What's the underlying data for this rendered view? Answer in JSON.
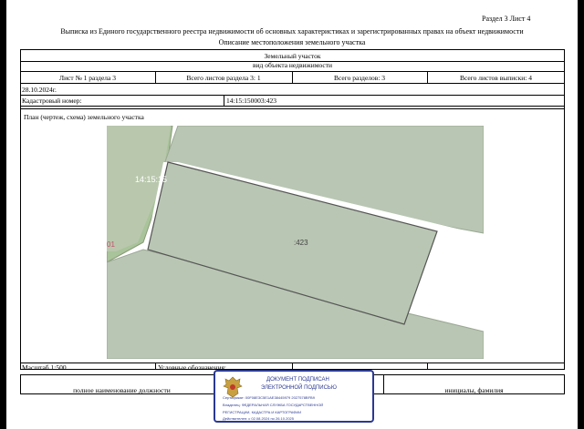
{
  "header": {
    "section": "Раздел 3    Лист 4",
    "title": "Выписка из Единого государственного реестра недвижимости об основных характеристиках и зарегистрированных правах на объект недвижимости",
    "subtitle": "Описание местоположения земельного участка"
  },
  "object": {
    "name": "Земельный участок",
    "kind": "вид объекта недвижимости"
  },
  "sheet_info": {
    "sheet_no": "Лист № 1 раздела 3",
    "total_sheets_section": "Всего листов раздела 3: 1",
    "total_sections": "Всего разделов: 3",
    "total_sheets_extract": "Всего листов выписки: 4"
  },
  "date": "28.10.2024г.",
  "cadastral": {
    "label": "Кадастровый номер:",
    "value": "14:15:150003:423"
  },
  "plan": {
    "label": "План (чертеж, схема) земельного участка",
    "parcel_label": ":423",
    "neighbor_label": "14:15:15",
    "neighbor_label2": "01"
  },
  "scale": "Масштаб 1:500",
  "legend_label": "Условные обозначения:",
  "footer": {
    "position_label": "полное наименование должности",
    "name_label": "инициалы, фамилия"
  },
  "stamp": {
    "line1": "ДОКУМЕНТ ПОДПИСАН",
    "line2": "ЭЛЕКТРОННОЙ ПОДПИСЬЮ",
    "certificate": "Сертификат: 00F08E3C5E1AE38445979 2027578BFB9",
    "owner": "Владелец: ФЕДЕРАЛЬНАЯ СЛУЖБА ГОСУДАРСТВЕННОЙ",
    "owner2": "РЕГИСТРАЦИИ, КАДАСТРА И КАРТОГРАФИИ",
    "valid": "Действителен: с 02.08.2024 по 26.10.2025"
  },
  "colors": {
    "parcel_fill": "#b9c6b3",
    "neighbor_fill": "#a9c39a",
    "stamp_border": "#2b3990",
    "neighbor_label": "#c0506a"
  }
}
